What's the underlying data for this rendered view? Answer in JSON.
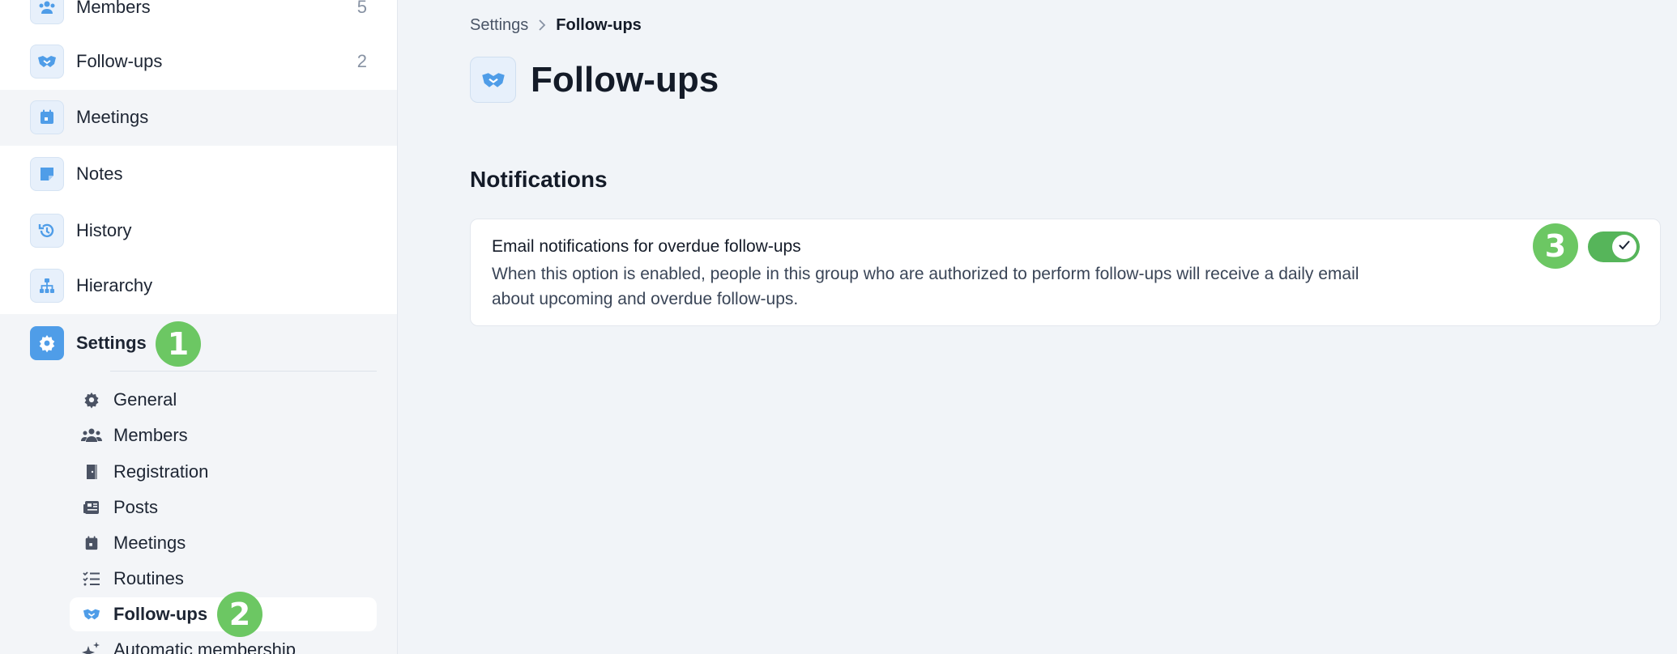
{
  "sidebar": {
    "nav": [
      {
        "label": "Members",
        "count": "5"
      },
      {
        "label": "Follow-ups",
        "count": "2"
      },
      {
        "label": "Meetings"
      },
      {
        "label": "Notes"
      },
      {
        "label": "History"
      },
      {
        "label": "Hierarchy"
      },
      {
        "label": "Settings"
      }
    ],
    "settings_sub": [
      {
        "label": "General"
      },
      {
        "label": "Members"
      },
      {
        "label": "Registration"
      },
      {
        "label": "Posts"
      },
      {
        "label": "Meetings"
      },
      {
        "label": "Routines"
      },
      {
        "label": "Follow-ups"
      },
      {
        "label": "Automatic membership"
      }
    ]
  },
  "badges": {
    "one": "1",
    "two": "2",
    "three": "3"
  },
  "breadcrumb": {
    "parent": "Settings",
    "current": "Follow-ups"
  },
  "page": {
    "title": "Follow-ups"
  },
  "notifications": {
    "section_title": "Notifications",
    "setting_title": "Email notifications for overdue follow-ups",
    "setting_description": "When this option is enabled, people in this group who are authorized to perform follow-ups will receive a daily email about upcoming and overdue follow-ups.",
    "enabled": true
  },
  "colors": {
    "accent": "#4f9de8",
    "badge": "#6cc763",
    "toggle_on": "#56b55a"
  }
}
